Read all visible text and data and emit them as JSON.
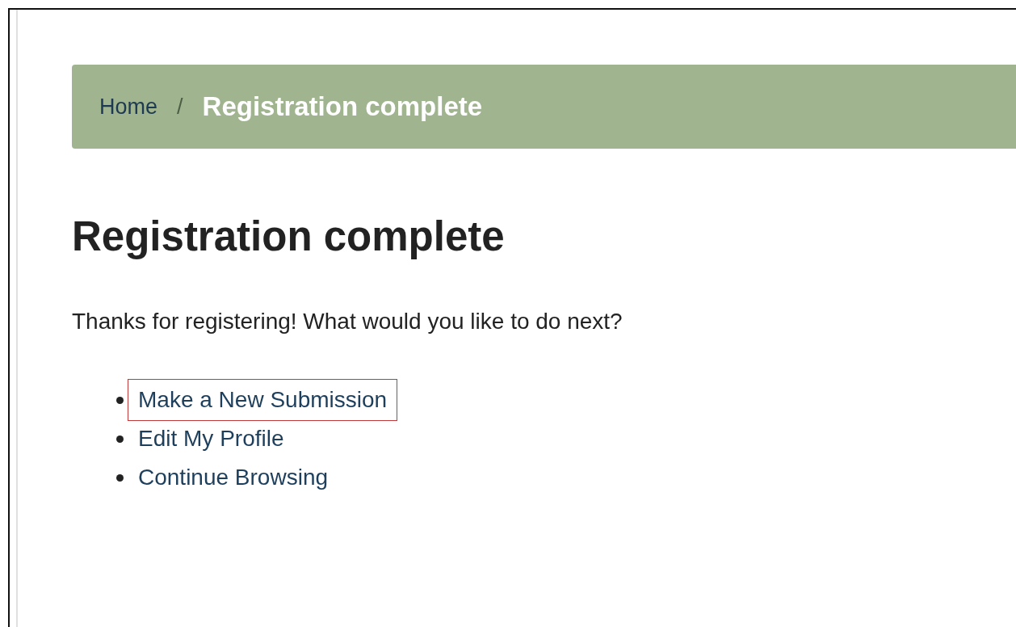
{
  "breadcrumb_separator": "/",
  "breadcrumb": [
    {
      "label": "Home",
      "current": false
    },
    {
      "label": "Registration complete",
      "current": true
    }
  ],
  "heading": "Registration complete",
  "message": "Thanks for registering! What would you like to do next?",
  "links": [
    {
      "label": "Make a New Submission",
      "highlighted": true
    },
    {
      "label": "Edit My Profile",
      "highlighted": false
    },
    {
      "label": "Continue Browsing",
      "highlighted": false
    }
  ]
}
